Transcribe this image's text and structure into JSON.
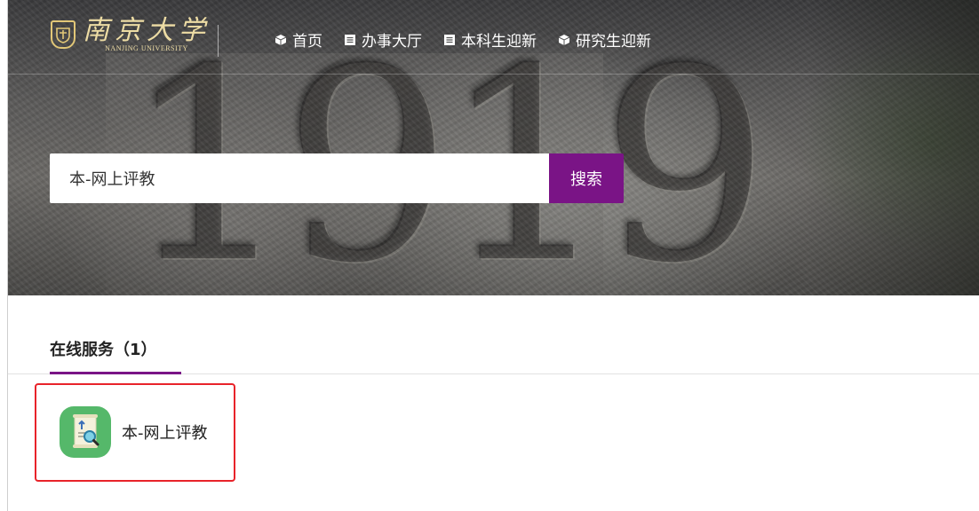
{
  "header": {
    "logo": {
      "chinese_name": "南京大学",
      "english_name": "NANJING UNIVERSITY"
    },
    "nav_items": [
      {
        "label": "首页",
        "icon": "cube-icon"
      },
      {
        "label": "办事大厅",
        "icon": "document-icon"
      },
      {
        "label": "本科生迎新",
        "icon": "document-icon"
      },
      {
        "label": "研究生迎新",
        "icon": "cube-icon"
      }
    ]
  },
  "banner": {
    "carved_text": "1919"
  },
  "search": {
    "value": "本-网上评教",
    "button_label": "搜索"
  },
  "tabs": [
    {
      "label": "在线服务（1）",
      "active": true
    }
  ],
  "services": [
    {
      "label": "本-网上评教",
      "icon": "evaluation-document-icon",
      "highlighted": true
    }
  ],
  "colors": {
    "accent": "#7a1486",
    "highlight": "#e8232a",
    "service_icon_bg": "#55b86a",
    "logo_gold": "#eddca4"
  }
}
